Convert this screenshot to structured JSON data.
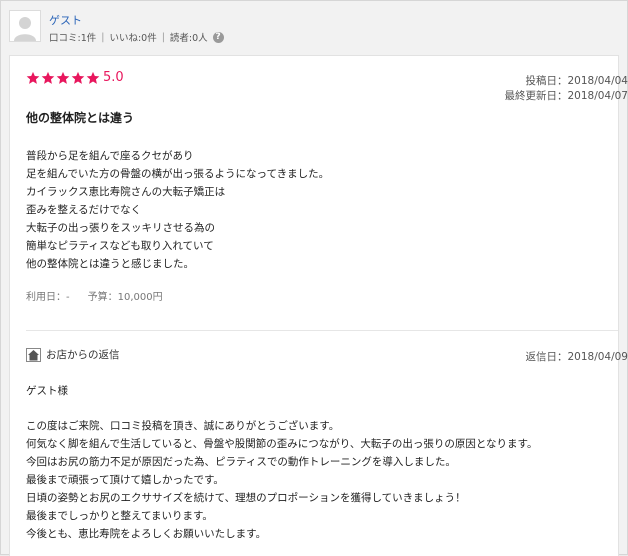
{
  "user": {
    "name": "ゲスト",
    "stats": [
      "口コミ:1件",
      "いいね:0件",
      "読者:0人"
    ],
    "help": "?"
  },
  "review": {
    "stars": 5,
    "rating_text": "5.0",
    "posted": "投稿日：2018/04/04",
    "updated": "最終更新日：2018/04/07",
    "title": "他の整体院とは違う",
    "body": [
      "普段から足を組んで座るクセがあり",
      "足を組んでいた方の骨盤の横が出っ張るようになってきました。",
      "カイラックス恵比寿院さんの大転子矯正は",
      "歪みを整えるだけでなく",
      "大転子の出っ張りをスッキリさせる為の",
      "簡単なピラティスなども取り入れていて",
      "他の整体院とは違うと感じました。"
    ],
    "usage_date": "利用日：-",
    "budget": "予算：10,000円"
  },
  "reply": {
    "label": "お店からの返信",
    "date": "返信日：2018/04/09",
    "greeting": "ゲスト様",
    "body": [
      "この度はご来院、口コミ投稿を頂き、誠にありがとうございます。",
      "何気なく脚を組んで生活していると、骨盤や股関節の歪みにつながり、大転子の出っ張りの原因となります。",
      "今回はお尻の筋力不足が原因だった為、ピラティスでの動作トレーニングを導入しました。",
      "最後まで頑張って頂けて嬉しかったです。",
      "日頃の姿勢とお尻のエクササイズを続けて、理想のプロポーションを獲得していきましょう！",
      "最後までしっかりと整えてまいります。",
      "今後とも、恵比寿院をよろしくお願いいたします。"
    ]
  },
  "colors": {
    "star": "#e8175d",
    "link": "#2a64b8"
  }
}
